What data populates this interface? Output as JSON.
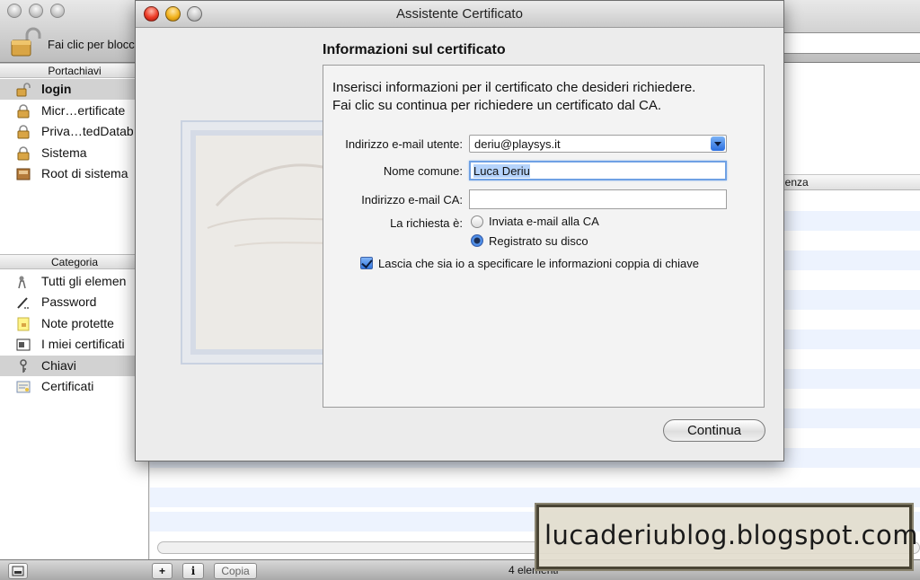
{
  "background_window": {
    "lock_label": "Fai clic per blocc",
    "keychains_header": "Portachiavi",
    "keychains": [
      {
        "label": "login",
        "icon": "open-lock-icon",
        "selected": true
      },
      {
        "label": "Micr…ertificate",
        "icon": "lock-icon",
        "selected": false
      },
      {
        "label": "Priva…tedDatab",
        "icon": "lock-icon",
        "selected": false
      },
      {
        "label": "Sistema",
        "icon": "lock-icon",
        "selected": false
      },
      {
        "label": "Root di sistema",
        "icon": "cabinet-icon",
        "selected": false
      }
    ],
    "categories_header": "Categoria",
    "categories": [
      {
        "label": "Tutti gli elemen",
        "icon": "people-icon",
        "selected": false
      },
      {
        "label": "Password",
        "icon": "password-icon",
        "selected": false
      },
      {
        "label": "Note protette",
        "icon": "note-icon",
        "selected": false
      },
      {
        "label": "I miei certificati",
        "icon": "my-certificates-icon",
        "selected": false
      },
      {
        "label": "Chiavi",
        "icon": "key-icon",
        "selected": true
      },
      {
        "label": "Certificati",
        "icon": "certificate-icon",
        "selected": false
      }
    ],
    "column_header": "denza",
    "bottom": {
      "add_label": "+",
      "info_label": "i",
      "copy_label": "Copia",
      "count_label": "4 elementi"
    }
  },
  "dialog": {
    "window_title": "Assistente Certificato",
    "section_title": "Informazioni sul certificato",
    "intro_line1": "Inserisci informazioni per il certificato che desideri richiedere.",
    "intro_line2": "Fai clic su continua per richiedere un certificato dal CA.",
    "email_label": "Indirizzo e-mail utente:",
    "email_value": "deriu@playsys.it",
    "common_name_label": "Nome comune:",
    "common_name_value": "Luca Deriu",
    "ca_email_label": "Indirizzo e-mail CA:",
    "ca_email_value": "",
    "request_label": "La richiesta è:",
    "option_email": "Inviata e-mail alla CA",
    "option_disk": "Registrato su disco",
    "selected_option": "Registrato su disco",
    "keypair_checkbox_label": "Lascia che sia io a specificare le informazioni coppia di chiave",
    "keypair_checked": true,
    "continue_label": "Continua"
  },
  "watermark_text": "lucaderiublog.blogspot.com",
  "colors": {
    "accent": "#2d6fd8",
    "selection": "#b5d3fb",
    "stripe": "#edf3fe"
  }
}
